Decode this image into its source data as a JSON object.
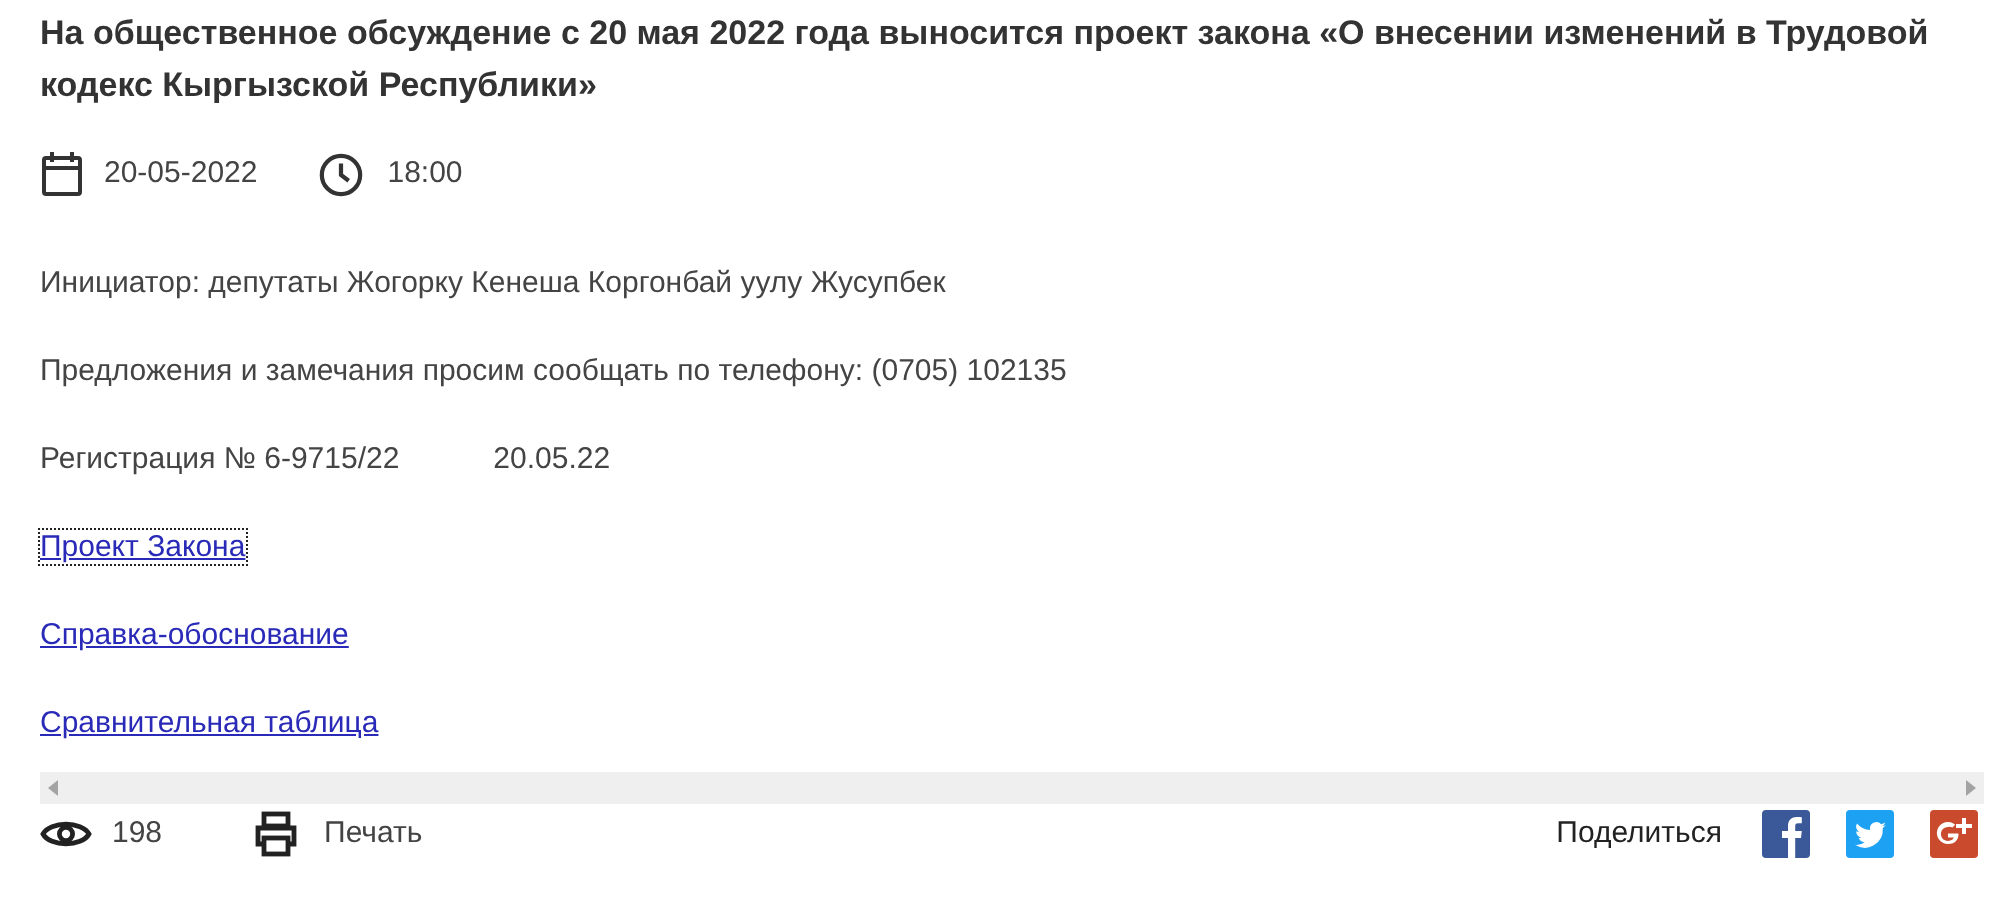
{
  "title": "На общественное обсуждение с 20 мая 2022 года выносится проект закона «О внесении изменений в Трудовой кодекс Кыргызской Республики»",
  "date": "20-05-2022",
  "time": "18:00",
  "paragraphs": [
    "Инициатор: депутаты Жогорку Кенеша Коргонбай уулу Жусупбек",
    "Предложения и замечания просим сообщать по телефону: (0705) 102135"
  ],
  "registration": {
    "number": "Регистрация № 6-9715/22",
    "date": "20.05.22"
  },
  "links": [
    {
      "label": "Проект Закона",
      "focused": true
    },
    {
      "label": "Справка-обоснование",
      "focused": false
    },
    {
      "label": "Сравнительная таблица",
      "focused": false
    }
  ],
  "footer": {
    "views": "198",
    "print": "Печать",
    "share": "Поделиться",
    "networks": [
      {
        "kind": "facebook"
      },
      {
        "kind": "twitter"
      },
      {
        "kind": "googleplus"
      }
    ]
  }
}
